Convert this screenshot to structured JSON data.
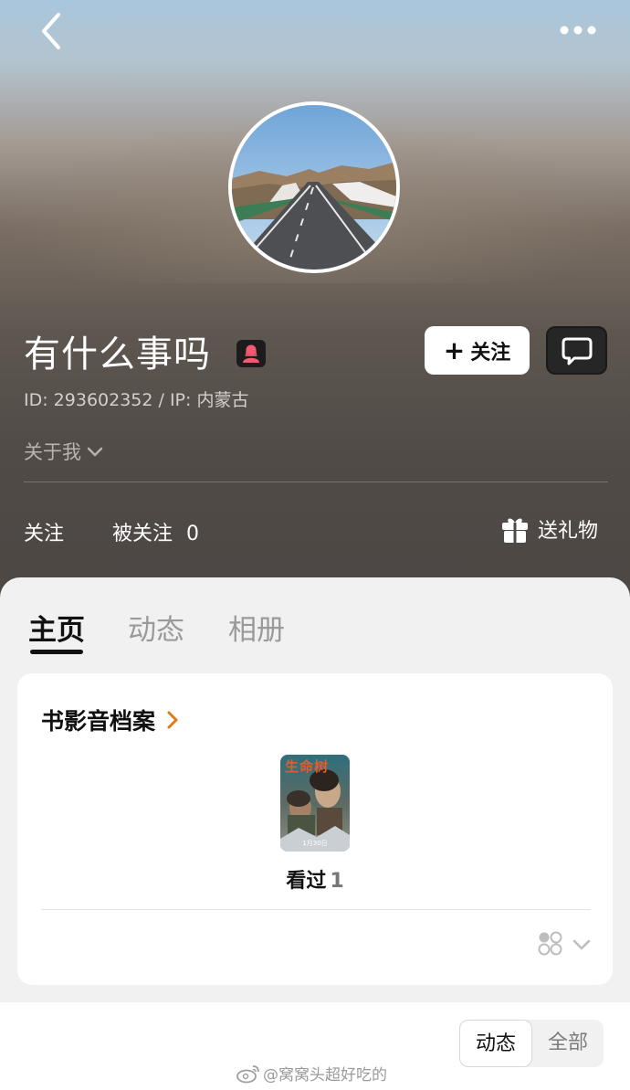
{
  "header": {
    "back_icon": "chevron-left-icon",
    "more_icon": "more-dots-icon"
  },
  "profile": {
    "username": "有什么事吗",
    "gender_icon": "female-user-icon",
    "id_line": "ID: 293602352 / IP: 内蒙古",
    "about_label": "关于我",
    "follow_button": "关注",
    "message_icon": "chat-bubble-icon"
  },
  "stats": {
    "following_label": "关注",
    "followers_label": "被关注",
    "followers_count": "0",
    "gift_label": "送礼物"
  },
  "tabs": [
    {
      "label": "主页",
      "active": true
    },
    {
      "label": "动态",
      "active": false
    },
    {
      "label": "相册",
      "active": false
    }
  ],
  "archive": {
    "title": "书影音档案",
    "seen_label": "看过",
    "seen_count": "1",
    "poster_title_text": "生命树",
    "poster_date_text": "1月30日"
  },
  "bottom": {
    "segment_active": "动态",
    "segment_inactive": "全部"
  },
  "watermark": {
    "text": "@窝窝头超好吃的"
  },
  "colors": {
    "accent_orange": "#e07b1a",
    "badge_pink": "#f15b72"
  }
}
